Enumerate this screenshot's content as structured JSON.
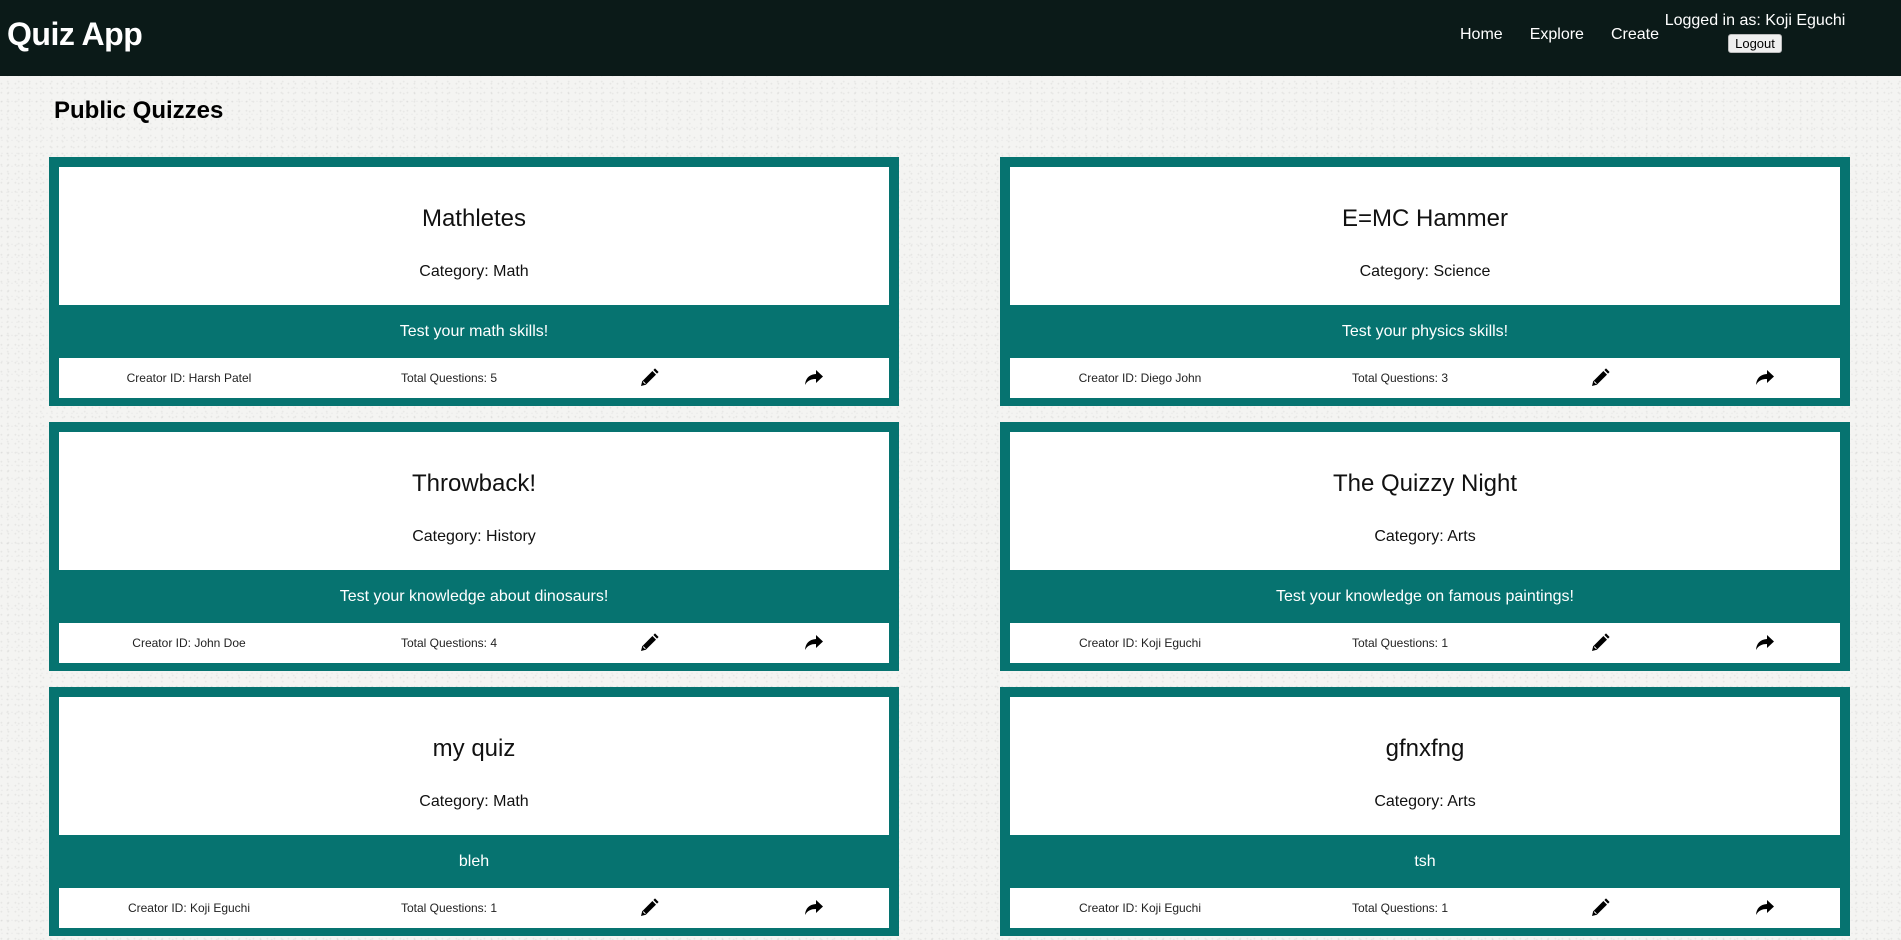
{
  "navbar": {
    "brand": "Quiz App",
    "links": [
      "Home",
      "Explore",
      "Create"
    ],
    "user_text": "Logged in as: Koji Eguchi",
    "logout_label": "Logout"
  },
  "page_title": "Public Quizzes",
  "colors": {
    "navbar_bg": "#0b1a18",
    "card_accent": "#067370"
  },
  "icons": {
    "edit": "pencil-icon",
    "share": "share-icon"
  },
  "quizzes": [
    {
      "title": "Mathletes",
      "category": "Category: Math",
      "description": "Test your math skills!",
      "creator": "Creator ID: Harsh Patel",
      "total_questions": "Total Questions: 5"
    },
    {
      "title": "E=MC Hammer",
      "category": "Category: Science",
      "description": "Test your physics skills!",
      "creator": "Creator ID: Diego John",
      "total_questions": "Total Questions: 3"
    },
    {
      "title": "Throwback!",
      "category": "Category: History",
      "description": "Test your knowledge about dinosaurs!",
      "creator": "Creator ID: John Doe",
      "total_questions": "Total Questions: 4"
    },
    {
      "title": "The Quizzy Night",
      "category": "Category: Arts",
      "description": "Test your knowledge on famous paintings!",
      "creator": "Creator ID: Koji Eguchi",
      "total_questions": "Total Questions: 1"
    },
    {
      "title": "my quiz",
      "category": "Category: Math",
      "description": "bleh",
      "creator": "Creator ID: Koji Eguchi",
      "total_questions": "Total Questions: 1"
    },
    {
      "title": "gfnxfng",
      "category": "Category: Arts",
      "description": "tsh",
      "creator": "Creator ID: Koji Eguchi",
      "total_questions": "Total Questions: 1"
    }
  ]
}
